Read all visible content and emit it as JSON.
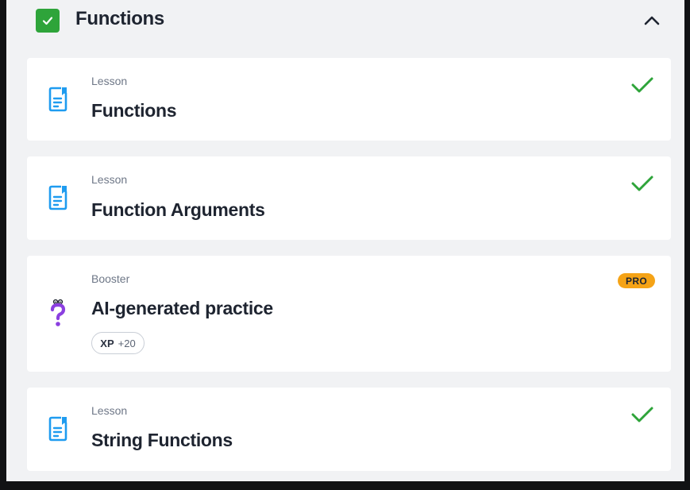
{
  "section": {
    "title": "Functions",
    "completed": true,
    "expanded": true
  },
  "items": [
    {
      "type": "Lesson",
      "title": "Functions",
      "completed": true,
      "icon": "lesson-document-icon"
    },
    {
      "type": "Lesson",
      "title": "Function Arguments",
      "completed": true,
      "icon": "lesson-document-icon"
    },
    {
      "type": "Booster",
      "title": "AI-generated practice",
      "badge": "PRO",
      "xp_label": "XP",
      "xp_value": "+20",
      "icon": "question-mark-icon"
    },
    {
      "type": "Lesson",
      "title": "String Functions",
      "completed": true,
      "icon": "lesson-document-icon"
    }
  ],
  "colors": {
    "success": "#2ea43a",
    "lesson_icon": "#1f9cf0",
    "booster_icon": "#8b3fe0",
    "pro_badge": "#f5a316"
  }
}
